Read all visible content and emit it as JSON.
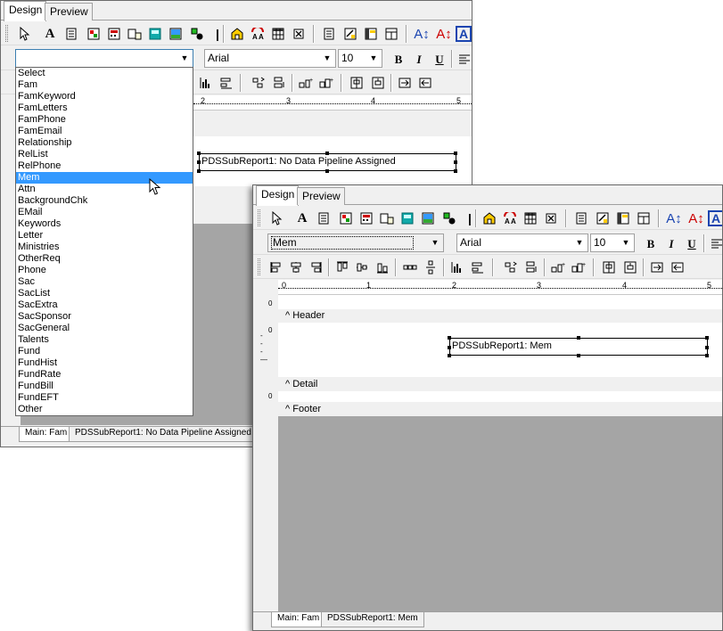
{
  "win1": {
    "tabs": [
      "Design",
      "Preview"
    ],
    "active_tab": "Design",
    "fieldCombo": "",
    "fontCombo": "Arial",
    "sizeCombo": "10",
    "ruler": [
      "2",
      "3",
      "4",
      "5"
    ],
    "subreport": "PDSSubReport1: No Data Pipeline Assigned",
    "dropdown": [
      "Select",
      "Fam",
      "FamKeyword",
      "FamLetters",
      "FamPhone",
      "FamEmail",
      "Relationship",
      "RelList",
      "RelPhone",
      "Mem",
      "Attn",
      "BackgroundChk",
      "EMail",
      "Keywords",
      "Letter",
      "Ministries",
      "OtherReq",
      "Phone",
      "Sac",
      "SacList",
      "SacExtra",
      "SacSponsor",
      "SacGeneral",
      "Talents",
      "Fund",
      "FundHist",
      "FundRate",
      "FundBill",
      "FundEFT",
      "Other"
    ],
    "dropdown_selected": "Mem",
    "bottomTabs": [
      "Main: Fam",
      "PDSSubReport1: No Data Pipeline Assigned"
    ]
  },
  "win2": {
    "tabs": [
      "Design",
      "Preview"
    ],
    "active_tab": "Design",
    "fieldCombo": "Mem",
    "fontCombo": "Arial",
    "sizeCombo": "10",
    "ruler": [
      "0",
      "1",
      "2",
      "3",
      "4",
      "5"
    ],
    "bands": {
      "header": "Header",
      "detail": "Detail",
      "footer": "Footer"
    },
    "marginLabel": "0",
    "subreport": "PDSSubReport1: Mem",
    "bottomTabs": [
      "Main: Fam",
      "PDSSubReport1: Mem"
    ]
  },
  "icons": [
    "pointer-icon",
    "label-icon",
    "memo-icon",
    "richtext-icon",
    "calc-icon",
    "variable-icon",
    "barcode-icon",
    "image-icon",
    "shape-icon",
    "line-icon",
    "region-icon",
    "subreport-icon",
    "crosstab-icon",
    "checkbox-icon",
    "dbtext-icon",
    "dbmemo-icon",
    "dbrichtext-icon",
    "dbcalc-icon",
    "font-color-icon",
    "highlight-color-icon",
    "anchor-icon",
    "bold-icon",
    "italic-icon",
    "underline-icon",
    "align-left-icon"
  ],
  "colors": {
    "selection": "#3399ff",
    "workspace": "#a5a5a5",
    "chrome": "#f0f0f0"
  }
}
